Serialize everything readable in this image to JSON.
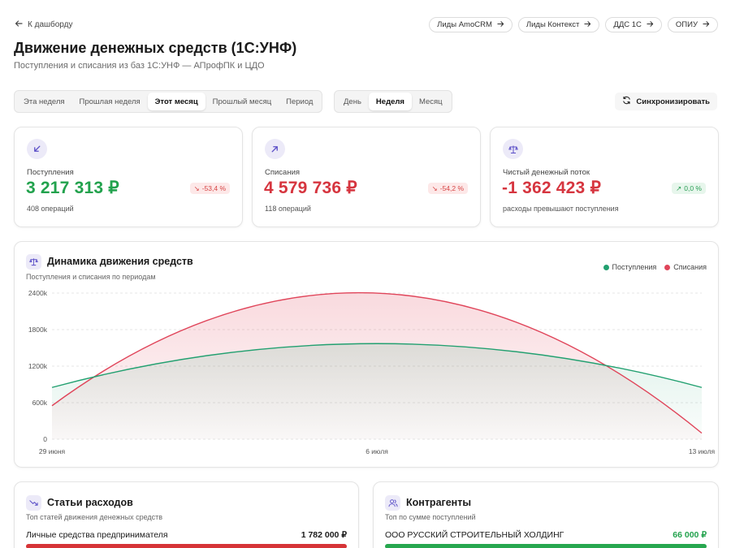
{
  "nav": {
    "back_label": "К дашборду"
  },
  "top_links": [
    {
      "label": "Лиды AmoCRM"
    },
    {
      "label": "Лиды Контекст"
    },
    {
      "label": "ДДС 1С"
    },
    {
      "label": "ОПИУ"
    }
  ],
  "page": {
    "title": "Движение денежных средств (1С:УНФ)",
    "subtitle": "Поступления и списания из баз 1С:УНФ — АПрофПК и ЦДО"
  },
  "period_filter": {
    "options": [
      "Эта неделя",
      "Прошлая неделя",
      "Этот месяц",
      "Прошлый месяц",
      "Период"
    ],
    "selected": "Этот месяц"
  },
  "granularity_filter": {
    "options": [
      "День",
      "Неделя",
      "Месяц"
    ],
    "selected": "Неделя"
  },
  "sync_button": {
    "label": "Синхронизировать"
  },
  "kpis": [
    {
      "label": "Поступления",
      "value": "3 217 313 ₽",
      "sub": "408 операций",
      "delta": "-53,4 %",
      "delta_dir": "down",
      "color": "#22a24d",
      "icon": "arrow-down-left-icon"
    },
    {
      "label": "Списания",
      "value": "4 579 736 ₽",
      "sub": "118 операций",
      "delta": "-54,2 %",
      "delta_dir": "down",
      "color": "#d6353f",
      "icon": "arrow-up-right-icon"
    },
    {
      "label": "Чистый денежный поток",
      "value": "-1 362 423 ₽",
      "sub": "расходы превышают поступления",
      "delta": "0,0 %",
      "delta_dir": "up",
      "color": "#d6353f",
      "icon": "scales-icon"
    }
  ],
  "dynamics": {
    "title": "Динамика движения средств",
    "subtitle": "Поступления и списания по периодам",
    "legend": [
      {
        "name": "Поступления",
        "color": "#22a070"
      },
      {
        "name": "Списания",
        "color": "#e0455a"
      }
    ]
  },
  "chart_data": {
    "type": "area",
    "x": [
      "29 июня",
      "6 июля",
      "13 июля"
    ],
    "yticks": [
      "0",
      "600k",
      "1200k",
      "1800k",
      "2400k"
    ],
    "ylim": [
      0,
      2400000
    ],
    "grid": true,
    "legend_position": "top-right",
    "series": [
      {
        "name": "Поступления",
        "values": [
          850000,
          1570000,
          850000
        ],
        "color": "#22a070"
      },
      {
        "name": "Списания",
        "values": [
          550000,
          2400000,
          100000
        ],
        "color": "#e0455a"
      }
    ]
  },
  "expenses": {
    "title": "Статьи расходов",
    "subtitle": "Топ статей движения денежных средств",
    "rows": [
      {
        "name": "Личные средства предпринимателя",
        "amount": "1 782 000 ₽",
        "color": "#d63437"
      }
    ]
  },
  "counterparties": {
    "title": "Контрагенты",
    "subtitle": "Топ по сумме поступлений",
    "rows": [
      {
        "name": "ООО РУССКИЙ СТРОИТЕЛЬНЫЙ ХОЛДИНГ",
        "amount": "66 000 ₽",
        "color": "#27a74f"
      }
    ]
  }
}
